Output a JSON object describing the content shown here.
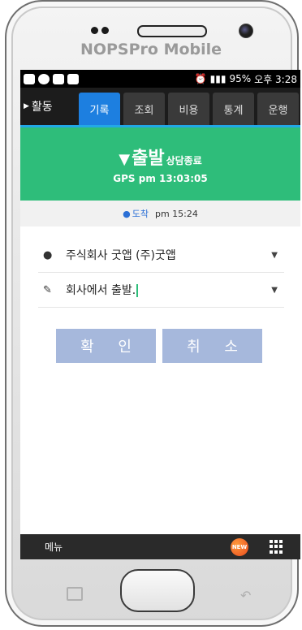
{
  "device": {
    "brand": "NOPSPro Mobile"
  },
  "statusbar": {
    "battery": "95%",
    "time": "오후 3:28"
  },
  "tabs": {
    "activity": "활동",
    "items": [
      {
        "label": "기록",
        "active": true
      },
      {
        "label": "조회"
      },
      {
        "label": "비용"
      },
      {
        "label": "통계"
      },
      {
        "label": "운행"
      }
    ]
  },
  "banner": {
    "title": "출발",
    "subtitle": "상담종료",
    "gps": "GPS pm 13:03:05",
    "color": "#2ebd7a"
  },
  "arrival": {
    "label": "도착",
    "time": "pm 15:24"
  },
  "form": {
    "company": "주식회사 굿앱 (주)굿앱",
    "memo": "회사에서 출발."
  },
  "buttons": {
    "confirm": "확 인",
    "cancel": "취 소"
  },
  "bottom": {
    "menu": "메뉴",
    "new_badge": "NEW"
  },
  "colors": {
    "accent": "#1d7fe0",
    "green": "#2ebd7a",
    "button": "#a6b8dc"
  }
}
